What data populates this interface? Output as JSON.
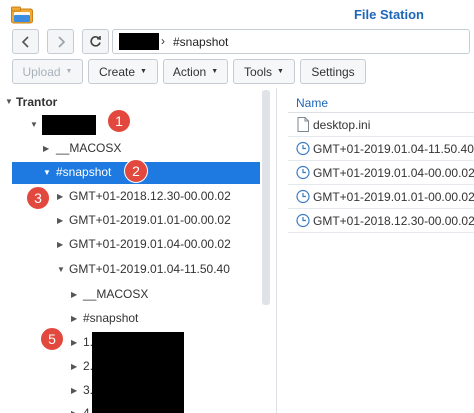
{
  "window": {
    "title": "File Station",
    "app_icon": "folder-icon"
  },
  "nav": {
    "back_icon": "chevron-left-icon",
    "forward_icon": "chevron-right-icon",
    "refresh_icon": "refresh-icon"
  },
  "path": {
    "separator": "›",
    "current": "#snapshot"
  },
  "toolbar": {
    "upload": "Upload",
    "create": "Create",
    "action": "Action",
    "tools": "Tools",
    "settings": "Settings"
  },
  "tree": {
    "root": "Trantor",
    "macosx_1": "__MACOSX",
    "snapshot_1": "#snapshot",
    "snap_a": "GMT+01-2018.12.30-00.00.02",
    "snap_b": "GMT+01-2019.01.01-00.00.02",
    "snap_c": "GMT+01-2019.01.04-00.00.02",
    "snap_d": "GMT+01-2019.01.04-11.50.40",
    "macosx_2": "__MACOSX",
    "snapshot_2": "#snapshot",
    "item_1": "1.",
    "item_2": "2.",
    "item_3": "3.",
    "item_4": "4."
  },
  "file_list": {
    "header": "Name",
    "files": [
      {
        "name": "desktop.ini",
        "icon": "file-icon"
      },
      {
        "name": "GMT+01-2019.01.04-11.50.40",
        "icon": "snapshot-icon"
      },
      {
        "name": "GMT+01-2019.01.04-00.00.02",
        "icon": "snapshot-icon"
      },
      {
        "name": "GMT+01-2019.01.01-00.00.02",
        "icon": "snapshot-icon"
      },
      {
        "name": "GMT+01-2018.12.30-00.00.02",
        "icon": "snapshot-icon"
      }
    ]
  },
  "annotations": {
    "b1": "1",
    "b2": "2",
    "b3": "3",
    "b5": "5"
  },
  "colors": {
    "accent": "#1e7ae0",
    "title": "#1d66b8",
    "badge": "#e2483d"
  }
}
